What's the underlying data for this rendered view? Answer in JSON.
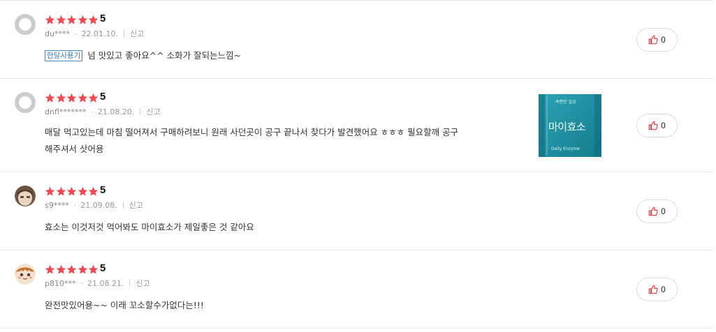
{
  "colors": {
    "star": "#f1484f",
    "tag_border": "#4a86c5",
    "like_icon": "#e0393e",
    "photo_bg": "#1f8fa3"
  },
  "reviews": [
    {
      "avatar": "default",
      "rating": 5,
      "score_label": "5",
      "user": "du****",
      "date": "22.01.10.",
      "report_label": "신고",
      "tag": "한달사용기",
      "lines": [
        "넘 맛있고 좋아요^^ 소화가 잘되는느낌~"
      ],
      "likes": "0"
    },
    {
      "avatar": "default",
      "rating": 5,
      "score_label": "5",
      "user": "dnfl*******",
      "date": "21.08.20.",
      "report_label": "신고",
      "lines": [
        "매달 먹고있는데 마침 떨어져서 구매하려보니 원래 사던곳이 공구 끝나서 찾다가 발견했어요 ㅎㅎㅎ 필요할깨 공구",
        "해주셔서 삿어용"
      ],
      "photo": {
        "top_text": "속편한 일상",
        "main_text": "마이효소",
        "sub_text": "Daily Enzyme"
      },
      "likes": "0"
    },
    {
      "avatar": "photo-brown",
      "rating": 5,
      "score_label": "5",
      "user": "s9****",
      "date": "21.09.08.",
      "report_label": "신고",
      "lines": [
        "효소는 이것저것 먹어봐도 마이효소가 제일좋은 것 같아요"
      ],
      "likes": "0"
    },
    {
      "avatar": "character-orange",
      "rating": 5,
      "score_label": "5",
      "user": "p810***",
      "date": "21.08.21.",
      "report_label": "신고",
      "lines": [
        "완전맛있어용~~ 이래 꼬소할수가없다는!!!"
      ],
      "likes": "0"
    }
  ]
}
